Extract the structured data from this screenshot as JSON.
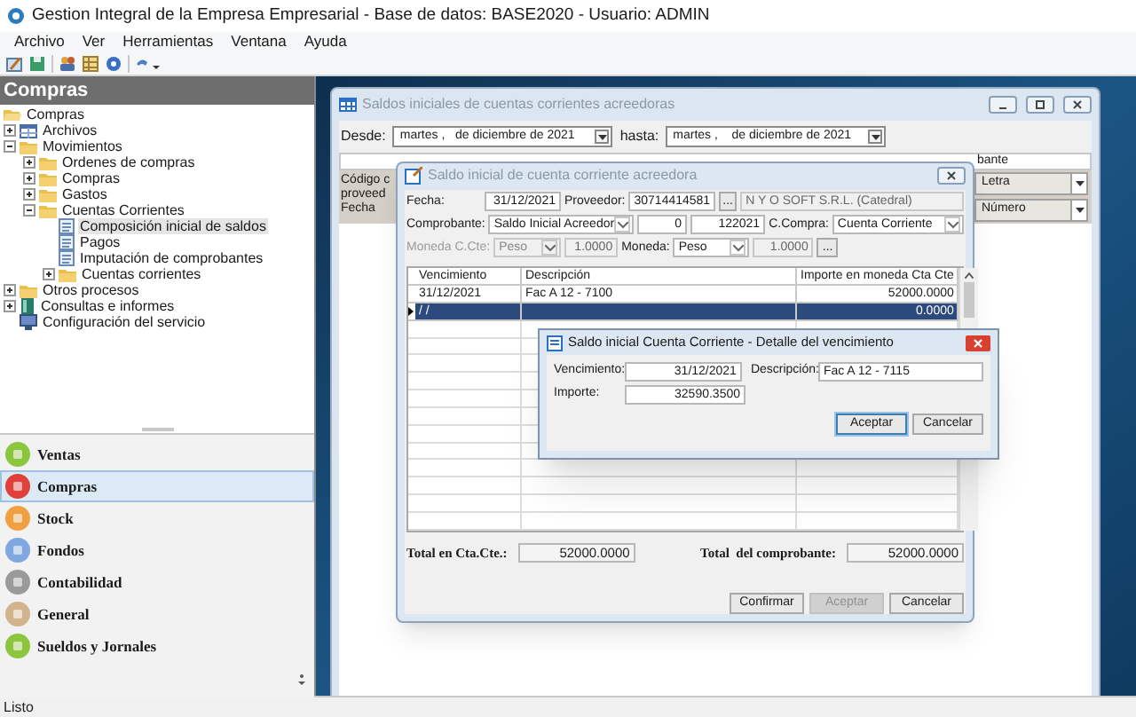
{
  "app": {
    "title": "Gestion Integral de la Empresa Empresarial - Base de datos: BASE2020 - Usuario: ADMIN",
    "menu": [
      "Archivo",
      "Ver",
      "Herramientas",
      "Ventana",
      "Ayuda"
    ]
  },
  "sidebar": {
    "header": "Compras",
    "tree": [
      {
        "label": "Compras",
        "kind": "root",
        "selected": false,
        "children": [
          {
            "label": "Archivos",
            "kind": "table",
            "expanded": false,
            "selected": false
          },
          {
            "label": "Movimientos",
            "kind": "folder",
            "expanded": true,
            "selected": false,
            "children": [
              {
                "label": "Ordenes de compras",
                "kind": "folder",
                "expanded": false,
                "selected": false
              },
              {
                "label": "Compras",
                "kind": "folder",
                "expanded": false,
                "selected": false
              },
              {
                "label": "Gastos",
                "kind": "folder",
                "expanded": false,
                "selected": false
              },
              {
                "label": "Cuentas Corrientes",
                "kind": "folder",
                "expanded": true,
                "selected": false,
                "children": [
                  {
                    "label": "Composición inicial de saldos",
                    "kind": "form",
                    "selected": true
                  },
                  {
                    "label": "Pagos",
                    "kind": "form",
                    "selected": false
                  },
                  {
                    "label": "Imputación de comprobantes",
                    "kind": "form",
                    "selected": false
                  },
                  {
                    "label": "Cuentas corrientes",
                    "kind": "folder",
                    "expanded": false,
                    "selected": false
                  }
                ]
              }
            ]
          },
          {
            "label": "Otros procesos",
            "kind": "folder",
            "expanded": false,
            "selected": false
          },
          {
            "label": "Consultas e informes",
            "kind": "book",
            "expanded": false,
            "selected": false
          },
          {
            "label": "Configuración del servicio",
            "kind": "config",
            "selected": false
          }
        ]
      }
    ],
    "modules": [
      {
        "label": "Ventas",
        "color": "#8cc63f",
        "selected": false
      },
      {
        "label": "Compras",
        "color": "#e0403a",
        "selected": true
      },
      {
        "label": "Stock",
        "color": "#f0a040",
        "selected": false
      },
      {
        "label": "Fondos",
        "color": "#7fa8e0",
        "selected": false
      },
      {
        "label": "Contabilidad",
        "color": "#9a9a9a",
        "selected": false
      },
      {
        "label": "General",
        "color": "#d2b48c",
        "selected": false
      },
      {
        "label": "Sueldos y Jornales",
        "color": "#8cc63f",
        "selected": false
      }
    ]
  },
  "list_window": {
    "title": "Saldos iniciales de cuentas corrientes acreedoras",
    "desde_label": "Desde:",
    "desde_value": "martes ,   de diciembre de 2021",
    "hasta_label": "hasta:",
    "hasta_value": "martes ,    de diciembre de 2021",
    "header_right": "bante",
    "left_labels": [
      "Código c",
      "proveed",
      "Fecha"
    ],
    "filters": [
      "Letra",
      "Número"
    ]
  },
  "dialog": {
    "title": "Saldo inicial de cuenta corriente acreedora",
    "lines": [
      {
        "fields": [
          {
            "kind": "label",
            "text": "Fecha:",
            "disabled": false
          },
          {
            "kind": "input",
            "text": "31/12/2021",
            "disabled": false
          },
          {
            "kind": "label",
            "text": "Proveedor:",
            "disabled": false
          },
          {
            "kind": "input",
            "text": "30714414581",
            "disabled": false
          },
          {
            "kind": "button",
            "text": "..."
          },
          {
            "kind": "input",
            "text": "N Y O SOFT S.R.L. (Catedral)",
            "disabled": true
          }
        ]
      },
      {
        "fields": [
          {
            "kind": "label",
            "text": "Comprobante:",
            "disabled": false
          },
          {
            "kind": "combo",
            "text": "Saldo Inicial Acreedor",
            "disabled": false
          },
          {
            "kind": "input",
            "text": "0",
            "disabled": false
          },
          {
            "kind": "input",
            "text": "122021",
            "disabled": false
          },
          {
            "kind": "label",
            "text": "C.Compra:",
            "disabled": false
          },
          {
            "kind": "combo",
            "text": "Cuenta Corriente",
            "disabled": false
          }
        ]
      },
      {
        "fields": [
          {
            "kind": "label",
            "text": "Moneda C.Cte:",
            "disabled": true
          },
          {
            "kind": "combo",
            "text": "Peso",
            "disabled": true
          },
          {
            "kind": "input",
            "text": "1.0000",
            "disabled": true
          },
          {
            "kind": "label",
            "text": "Moneda:",
            "disabled": false
          },
          {
            "kind": "combo",
            "text": "Peso",
            "disabled": false
          },
          {
            "kind": "input",
            "text": "1.0000",
            "disabled": true
          },
          {
            "kind": "button",
            "text": "..."
          }
        ]
      }
    ],
    "grid": {
      "columns": [
        "Vencimiento",
        "Descripción",
        "Importe en moneda Cta Cte"
      ],
      "rows": [
        {
          "vencimiento": "31/12/2021",
          "descripcion": "Fac A 12 - 7100",
          "importe": "52000.0000",
          "selected": false
        },
        {
          "vencimiento": "/ /",
          "importe": "0.0000",
          "selected": true
        }
      ]
    },
    "totals": [
      {
        "label": "Total en Cta.Cte.:",
        "value": "52000.0000"
      },
      {
        "label": "Total  del comprobante:",
        "value": "52000.0000"
      }
    ],
    "buttons": [
      {
        "label": "Confirmar",
        "disabled": false
      },
      {
        "label": "Aceptar",
        "disabled": true
      },
      {
        "label": "Cancelar",
        "disabled": false
      }
    ]
  },
  "detail_dialog": {
    "title": "Saldo inicial Cuenta Corriente - Detalle del vencimiento",
    "vencimiento_label": "Vencimiento:",
    "vencimiento": "31/12/2021",
    "descripcion_label": "Descripción:",
    "descripcion": "Fac A 12 - 7115",
    "importe_label": "Importe:",
    "importe": "32590.3500",
    "buttons": [
      {
        "label": "Aceptar",
        "default": true
      },
      {
        "label": "Cancelar",
        "default": false
      }
    ]
  },
  "status_bar": "Listo"
}
